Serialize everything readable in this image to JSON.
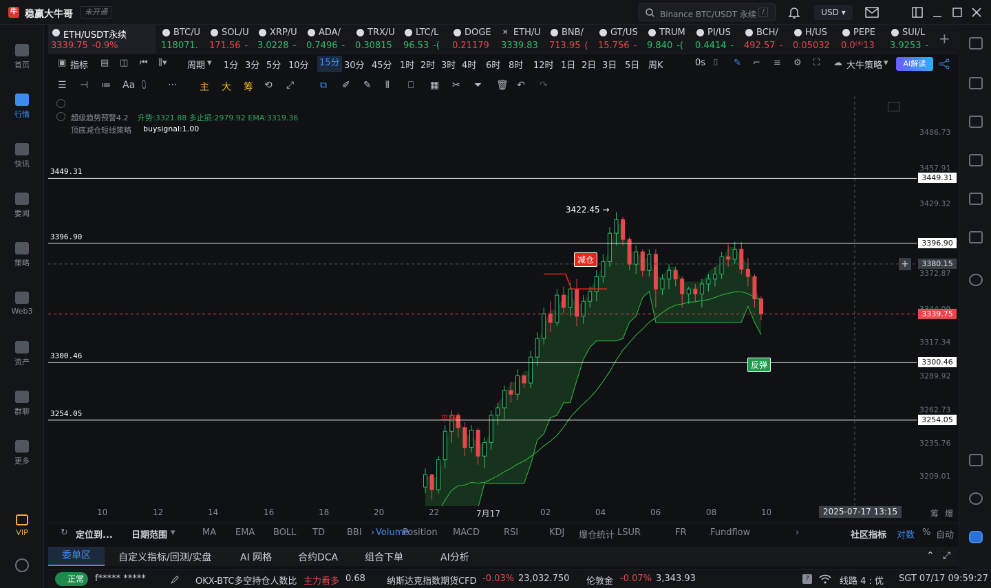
{
  "app": {
    "title": "稳赢大牛哥",
    "badge": "未开通",
    "logo": "牛",
    "search_placeholder": "Binance BTC/USDT 永续",
    "search_key": "/",
    "currency": "USD"
  },
  "sidebar": [
    {
      "label": "首页",
      "icon": "home-icon"
    },
    {
      "label": "行情",
      "icon": "chart-bars-icon",
      "active": true
    },
    {
      "label": "快讯",
      "icon": "news-icon"
    },
    {
      "label": "要闻",
      "icon": "article-icon"
    },
    {
      "label": "策略",
      "icon": "robot-icon"
    },
    {
      "label": "Web3",
      "icon": "web3-icon"
    },
    {
      "label": "资产",
      "icon": "wallet-icon"
    },
    {
      "label": "群聊",
      "icon": "chat-icon"
    },
    {
      "label": "更多",
      "icon": "grid-icon"
    },
    {
      "label": "VIP",
      "icon": "diamond-icon"
    }
  ],
  "tabs": [
    {
      "name": "ETH/USDT永续",
      "price": "3339.75",
      "change": "-0.9%",
      "dir": "dn",
      "active": true
    },
    {
      "name": "BTC/U",
      "price": "118071.",
      "change": "",
      "dir": "up"
    },
    {
      "name": "SOL/U",
      "price": "171.56",
      "change": "-",
      "dir": "dn"
    },
    {
      "name": "XRP/U",
      "price": "3.0228",
      "change": "-",
      "dir": "up"
    },
    {
      "name": "ADA/",
      "price": "0.7496",
      "change": "-",
      "dir": "up"
    },
    {
      "name": "TRX/U",
      "price": "0.30815",
      "change": "",
      "dir": "up"
    },
    {
      "name": "LTC/L",
      "price": "96.53",
      "change": "-(",
      "dir": "up"
    },
    {
      "name": "DOGE",
      "price": "0.21179",
      "change": "",
      "dir": "dn"
    },
    {
      "name": "ETH/U",
      "price": "3339.83",
      "change": "",
      "dir": "up"
    },
    {
      "name": "BNB/",
      "price": "713.95",
      "change": "(",
      "dir": "dn"
    },
    {
      "name": "GT/US",
      "price": "15.756",
      "change": "-",
      "dir": "dn"
    },
    {
      "name": "TRUM",
      "price": "9.840",
      "change": "-(",
      "dir": "up"
    },
    {
      "name": "PI/US",
      "price": "0.4414",
      "change": "-",
      "dir": "up"
    },
    {
      "name": "BCH/",
      "price": "492.57",
      "change": "-",
      "dir": "dn"
    },
    {
      "name": "H/US",
      "price": "0.05032",
      "change": "",
      "dir": "dn"
    },
    {
      "name": "PEPE",
      "price": "0.0⁽⁴⁾13",
      "change": "",
      "dir": "dn"
    },
    {
      "name": "SUI/L",
      "price": "3.9253",
      "change": "-",
      "dir": "up"
    }
  ],
  "toolbar": {
    "indicator": "指标",
    "period": "周期",
    "intervals": [
      "1分",
      "3分",
      "5分",
      "10分",
      "15分",
      "30分",
      "45分",
      "1时",
      "2时",
      "3时",
      "4时",
      "6时",
      "8时",
      "12时",
      "1日",
      "2日",
      "3日",
      "5日",
      "周K"
    ],
    "selected_interval": "15分",
    "countdown": "0s",
    "strategy": "大牛策略",
    "ai_button": "AI解读"
  },
  "drawing_tools": {
    "labels": [
      "Aa",
      "主",
      "大",
      "筹"
    ]
  },
  "indicators": {
    "line1_name": "超级趋势预警4.2",
    "line1_values": "升势:3321.88  多止损:2979.92  EMA:3319.36",
    "line2_name": "顶底减仓短线策略",
    "line2_value": "buysignal:1.00"
  },
  "chart_data": {
    "type": "candlestick",
    "symbol": "ETH/USDT永续",
    "interval": "15分",
    "y_ticks": [
      3486.73,
      3457.91,
      3429.32,
      3372.87,
      3344.09,
      3317.34,
      3289.92,
      3262.73,
      3235.76,
      3209.01
    ],
    "x_ticks": [
      "10",
      "12",
      "14",
      "16",
      "18",
      "20",
      "22",
      "7月17",
      "02",
      "04",
      "06",
      "08",
      "10"
    ],
    "horizontal_lines": [
      {
        "value": "3449.31",
        "label": "3449.31"
      },
      {
        "value": "3396.90",
        "label": "3396.90"
      },
      {
        "value": "3300.46",
        "label": "3300.46"
      },
      {
        "value": "3254.05",
        "label": "3254.05"
      }
    ],
    "last_price": "3339.75",
    "crosshair_price": "3380.15",
    "crosshair_time": "2025-07-17 13:15",
    "high_marker": "3422.45 →",
    "signals": [
      {
        "text": "减仓",
        "color": "#e5261f"
      },
      {
        "text": "反弹",
        "color": "#1f9d4a"
      },
      {
        "text": "平多",
        "color": "#e5261f"
      }
    ],
    "candles": [
      [
        3200,
        3215,
        3195,
        3210
      ],
      [
        3210,
        3205,
        3190,
        3198
      ],
      [
        3198,
        3225,
        3195,
        3222
      ],
      [
        3222,
        3250,
        3215,
        3245
      ],
      [
        3245,
        3262,
        3236,
        3258
      ],
      [
        3258,
        3260,
        3240,
        3248
      ],
      [
        3248,
        3252,
        3225,
        3232
      ],
      [
        3232,
        3250,
        3228,
        3246
      ],
      [
        3246,
        3248,
        3218,
        3225
      ],
      [
        3225,
        3240,
        3215,
        3236
      ],
      [
        3236,
        3262,
        3230,
        3258
      ],
      [
        3258,
        3268,
        3250,
        3264
      ],
      [
        3264,
        3282,
        3255,
        3278
      ],
      [
        3278,
        3285,
        3268,
        3275
      ],
      [
        3275,
        3295,
        3270,
        3290
      ],
      [
        3290,
        3288,
        3280,
        3284
      ],
      [
        3284,
        3310,
        3280,
        3305
      ],
      [
        3305,
        3325,
        3298,
        3320
      ],
      [
        3320,
        3345,
        3315,
        3340
      ],
      [
        3340,
        3350,
        3325,
        3333
      ],
      [
        3333,
        3360,
        3330,
        3355
      ],
      [
        3355,
        3362,
        3340,
        3345
      ],
      [
        3345,
        3365,
        3338,
        3360
      ],
      [
        3360,
        3368,
        3330,
        3338
      ],
      [
        3338,
        3355,
        3332,
        3350
      ],
      [
        3350,
        3362,
        3345,
        3358
      ],
      [
        3358,
        3375,
        3350,
        3370
      ],
      [
        3370,
        3388,
        3365,
        3382
      ],
      [
        3382,
        3410,
        3378,
        3405
      ],
      [
        3405,
        3422,
        3395,
        3416
      ],
      [
        3416,
        3418,
        3395,
        3400
      ],
      [
        3400,
        3402,
        3375,
        3380
      ],
      [
        3380,
        3395,
        3372,
        3390
      ],
      [
        3390,
        3392,
        3370,
        3375
      ],
      [
        3375,
        3392,
        3370,
        3388
      ],
      [
        3388,
        3392,
        3345,
        3360
      ],
      [
        3360,
        3372,
        3355,
        3368
      ],
      [
        3368,
        3380,
        3360,
        3375
      ],
      [
        3375,
        3378,
        3362,
        3368
      ],
      [
        3368,
        3370,
        3345,
        3356
      ],
      [
        3356,
        3362,
        3348,
        3360
      ],
      [
        3360,
        3364,
        3350,
        3356
      ],
      [
        3356,
        3368,
        3345,
        3364
      ],
      [
        3364,
        3372,
        3358,
        3368
      ],
      [
        3368,
        3378,
        3362,
        3372
      ],
      [
        3372,
        3390,
        3368,
        3386
      ],
      [
        3386,
        3396,
        3378,
        3384
      ],
      [
        3384,
        3398,
        3380,
        3392
      ],
      [
        3392,
        3398,
        3372,
        3376
      ],
      [
        3376,
        3385,
        3362,
        3370
      ],
      [
        3370,
        3372,
        3345,
        3352
      ],
      [
        3352,
        3354,
        3335,
        3340
      ]
    ]
  },
  "x_axis_right": {
    "a": "筹",
    "b": "爆"
  },
  "panel_tabs": {
    "locate": "定位到...",
    "date_range": "日期范围",
    "items": [
      "MA",
      "EMA",
      "BOLL",
      "TD",
      "BBI",
      "Volume",
      "Position",
      "MACD",
      "RSI",
      "KDJ",
      "爆仓统计",
      "LSUR",
      "FR",
      "Fundflow"
    ],
    "active": "Volume",
    "community": "社区指标",
    "log": "对数",
    "percent": "%",
    "auto": "自动"
  },
  "order_tabs": {
    "items": [
      "委单区",
      "自定义指标/回测/实盘",
      "AI 网格",
      "合约DCA",
      "组合下单",
      "AI分析"
    ],
    "active": "委单区"
  },
  "statusbar": {
    "status": "正常",
    "user": "f*****  *****",
    "ticker1_name": "OKX-BTC多空持仓人数比",
    "ticker1_tag": "主力看多",
    "ticker1_value": "0.68",
    "ticker2_name": "纳斯达克指数期货CFD",
    "ticker2_change": "-0.03%",
    "ticker2_value": "23,032.750",
    "ticker3_name": "伦敦金",
    "ticker3_change": "-0.07%",
    "ticker3_value": "3,343.93",
    "line": "线路 4 : 优",
    "clock": "SGT 07/17 09:59:27"
  }
}
